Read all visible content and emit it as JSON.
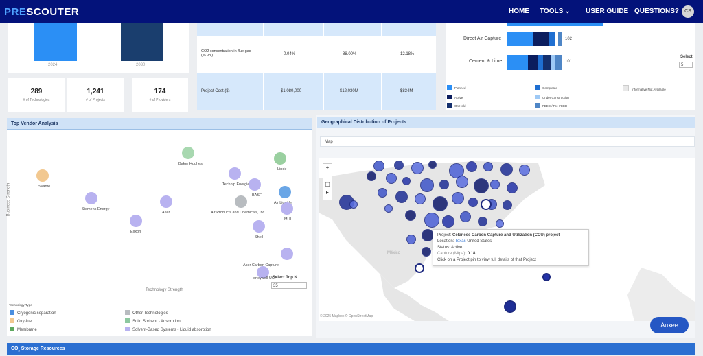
{
  "nav": {
    "logo_pre": "PRE",
    "logo_rest": "SCOUTER",
    "items": [
      "HOME",
      "TOOLS",
      "USER GUIDE",
      "QUESTIONS?"
    ],
    "avatar": "CS"
  },
  "bar_chart": {
    "type": "bar",
    "categories": [
      "2024",
      "2030"
    ],
    "colors": [
      "#2b8ff5",
      "#1a3e6e"
    ]
  },
  "stats": [
    {
      "value": "289",
      "label": "# of Technologies"
    },
    {
      "value": "1,241",
      "label": "# of Projects"
    },
    {
      "value": "174",
      "label": "# of Providers"
    }
  ],
  "compare_table": {
    "rows": [
      {
        "label": "CO2 concentration in flue gas (% vol)",
        "values": [
          "0.04%",
          "88.00%",
          "12.18%"
        ]
      },
      {
        "label": "Project Cost ($)",
        "values": [
          "$1,080,000",
          "$12,030M",
          "$834M"
        ]
      }
    ]
  },
  "capture_bars": {
    "rows": [
      {
        "label": "Direct Air Capture",
        "value": "102"
      },
      {
        "label": "Cement & Lime",
        "value": "101"
      }
    ],
    "select_label": "Select",
    "select_value": "5",
    "legend": [
      {
        "label": "Planned",
        "color": "#2b8ff5"
      },
      {
        "label": "Completed",
        "color": "#1f6fd1"
      },
      {
        "label": "Informative Not Available",
        "color": "#e8e8e8"
      },
      {
        "label": "Active",
        "color": "#0b1d5e"
      },
      {
        "label": "Under Construction",
        "color": "#9ec9f5"
      },
      {
        "label": "On Hold",
        "color": "#14306e"
      },
      {
        "label": "FEED / Pre-FEED",
        "color": "#4f86c6"
      }
    ]
  },
  "vendor": {
    "title": "Top Vendor Analysis",
    "xlabel": "Technology Strength",
    "ylabel": "Business Strength",
    "select_top_label": "Select Top N",
    "select_top_value": "35",
    "points": [
      {
        "name": "Siemens Energy",
        "color": "#b8b2f0"
      },
      {
        "name": "Baker Hughes",
        "color": "#a8d8b0"
      },
      {
        "name": "Linde",
        "color": "#9ad0a0"
      },
      {
        "name": "Technip Energies",
        "color": "#b8b2f0"
      },
      {
        "name": "BASF",
        "color": "#b8b2f0"
      },
      {
        "name": "Air Liquide",
        "color": "#6aa6e6"
      },
      {
        "name": "Svante",
        "color": "#f2c890"
      },
      {
        "name": "Aker",
        "color": "#b8b2f0"
      },
      {
        "name": "Air Products and Chemicals, Inc",
        "color": "#b8bcc0"
      },
      {
        "name": "MHI",
        "color": "#b8b2f0"
      },
      {
        "name": "Shell",
        "color": "#b8b2f0"
      },
      {
        "name": "Exxon",
        "color": "#b8b2f0"
      },
      {
        "name": "Honeywell UOP",
        "color": "#b8b2f0"
      },
      {
        "name": "Aker Carbon Capture",
        "color": "#b8b2f0"
      }
    ],
    "legend_title": "Technology Type",
    "legend": [
      {
        "label": "Cryogenic separation",
        "color": "#4a8fe0"
      },
      {
        "label": "Other Technologies",
        "color": "#b8bcc0"
      },
      {
        "label": "Oxy-fuel",
        "color": "#f2c890"
      },
      {
        "label": "Solid Sorbent - Adsorption",
        "color": "#8dc8a0"
      },
      {
        "label": "Membrane",
        "color": "#5ea85e"
      },
      {
        "label": "Solvent-Based Systems - Liquid absorption",
        "color": "#b8b2f0"
      }
    ]
  },
  "geo": {
    "title": "Geographical Distribution of Projects",
    "tab": "Map",
    "tooltip": {
      "project_label": "Project:",
      "project": "Celanese Carbon Capture and Utilization (CCU) project",
      "location_label": "Location:",
      "location_link": "Texas",
      "location_rest": "United States",
      "status_label": "Status:",
      "status": "Active",
      "capture_label": "Capture (Mtpa):",
      "capture": "0.18",
      "hint": "Click on a Project pin to view full details of that Project"
    },
    "attribution": "© 2025 Mapbox © OpenStreetMap",
    "map_label": "México"
  },
  "footer": {
    "storage_title": "Storage Resources",
    "storage_prefix": "CO",
    "storage_sub": "2"
  },
  "chat_button": "Auxee"
}
